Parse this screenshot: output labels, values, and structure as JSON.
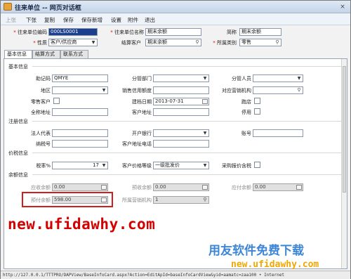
{
  "window": {
    "title": "往来单位 --  网页对话框",
    "close": "×"
  },
  "toolbar": {
    "items": [
      "上张",
      "下张",
      "复制",
      "保存",
      "保存新增",
      "设置",
      "附件",
      "退出"
    ]
  },
  "header": {
    "code_label": "往来单位编码",
    "code_value": "000LS0001",
    "name_label": "往来单位名称",
    "name_value": "期末余额",
    "short_label": "简称",
    "short_value": "期末余额",
    "nature_label": "性质",
    "nature_value": "客户/供应商",
    "settle_label": "结算客户",
    "settle_value": "期末余额",
    "category_label": "所属类别",
    "category_value": "零售"
  },
  "tabs": [
    "基本信息",
    "结算方式",
    "联系方式"
  ],
  "basic": {
    "section_title": "基本信息",
    "mnemonic_label": "助记码",
    "mnemonic_value": "QMYE",
    "dept_label": "分管部门",
    "staff_label": "分管人员",
    "region_label": "地区",
    "credit_label": "销售信用额度",
    "org_label": "对应营销机构",
    "retail_label": "零售客户",
    "created_label": "建档日期",
    "created_value": "2013-07-31",
    "store_label": "跑店",
    "full_addr_label": "全称地址",
    "cust_addr_label": "客户地址",
    "disabled_label": "停用"
  },
  "registration": {
    "section_title": "注册信息",
    "legal_label": "法人代表",
    "bank_label": "开户银行",
    "account_label": "账号",
    "tax_label": "纳税号",
    "phone_label": "客户地址电话"
  },
  "price": {
    "section_title": "价税信息",
    "rate_label": "税率%",
    "rate_value": "17",
    "price_level_label": "客户价格等级",
    "price_level_value": "一级批发价",
    "purchase_label": "采购报价含税"
  },
  "balance": {
    "section_title": "余额信息",
    "receivable_label": "应收余额",
    "receivable_value": "0.00",
    "prereceive_label": "预收余额",
    "prereceive_value": "0.00",
    "payable_label": "应付余额",
    "payable_value": "0.00",
    "prepay_label": "预付余额",
    "prepay_value": "598.00",
    "org2_label": "所属营销机构",
    "org2_value": "1"
  },
  "status": {
    "url": "http://127.0.0.1/TTTPRO/DAPView/BaseInfoCard.aspx?Action=EditApId=baseInfoCardView&yid=aamatc=zaa100 • Internet"
  },
  "watermark": {
    "site": "new.ufidawhy.com",
    "cn": "用友软件免费下载",
    "site2": "new.ufidawhy.com"
  }
}
